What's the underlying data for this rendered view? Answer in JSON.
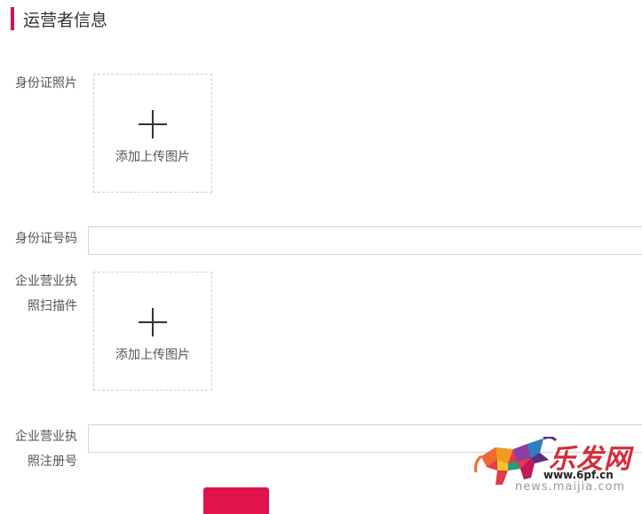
{
  "section": {
    "title": "运营者信息",
    "accent_color": "#c8174f"
  },
  "fields": {
    "id_photo": {
      "label": "身份证照片",
      "upload_label": "添加上传图片"
    },
    "id_number": {
      "label": "身份证号码",
      "value": ""
    },
    "license_scan": {
      "label_line1": "企业营业执",
      "label_line2": "照扫描件",
      "upload_label": "添加上传图片"
    },
    "license_number": {
      "label_line1": "企业营业执",
      "label_line2": "照注册号",
      "value": ""
    }
  },
  "submit": {
    "color": "#e0144b"
  },
  "watermark": {
    "title": "乐发网",
    "domain": "www.6pf.cn",
    "sub": "news.maijia.com",
    "icon": "bull-logo-icon"
  }
}
